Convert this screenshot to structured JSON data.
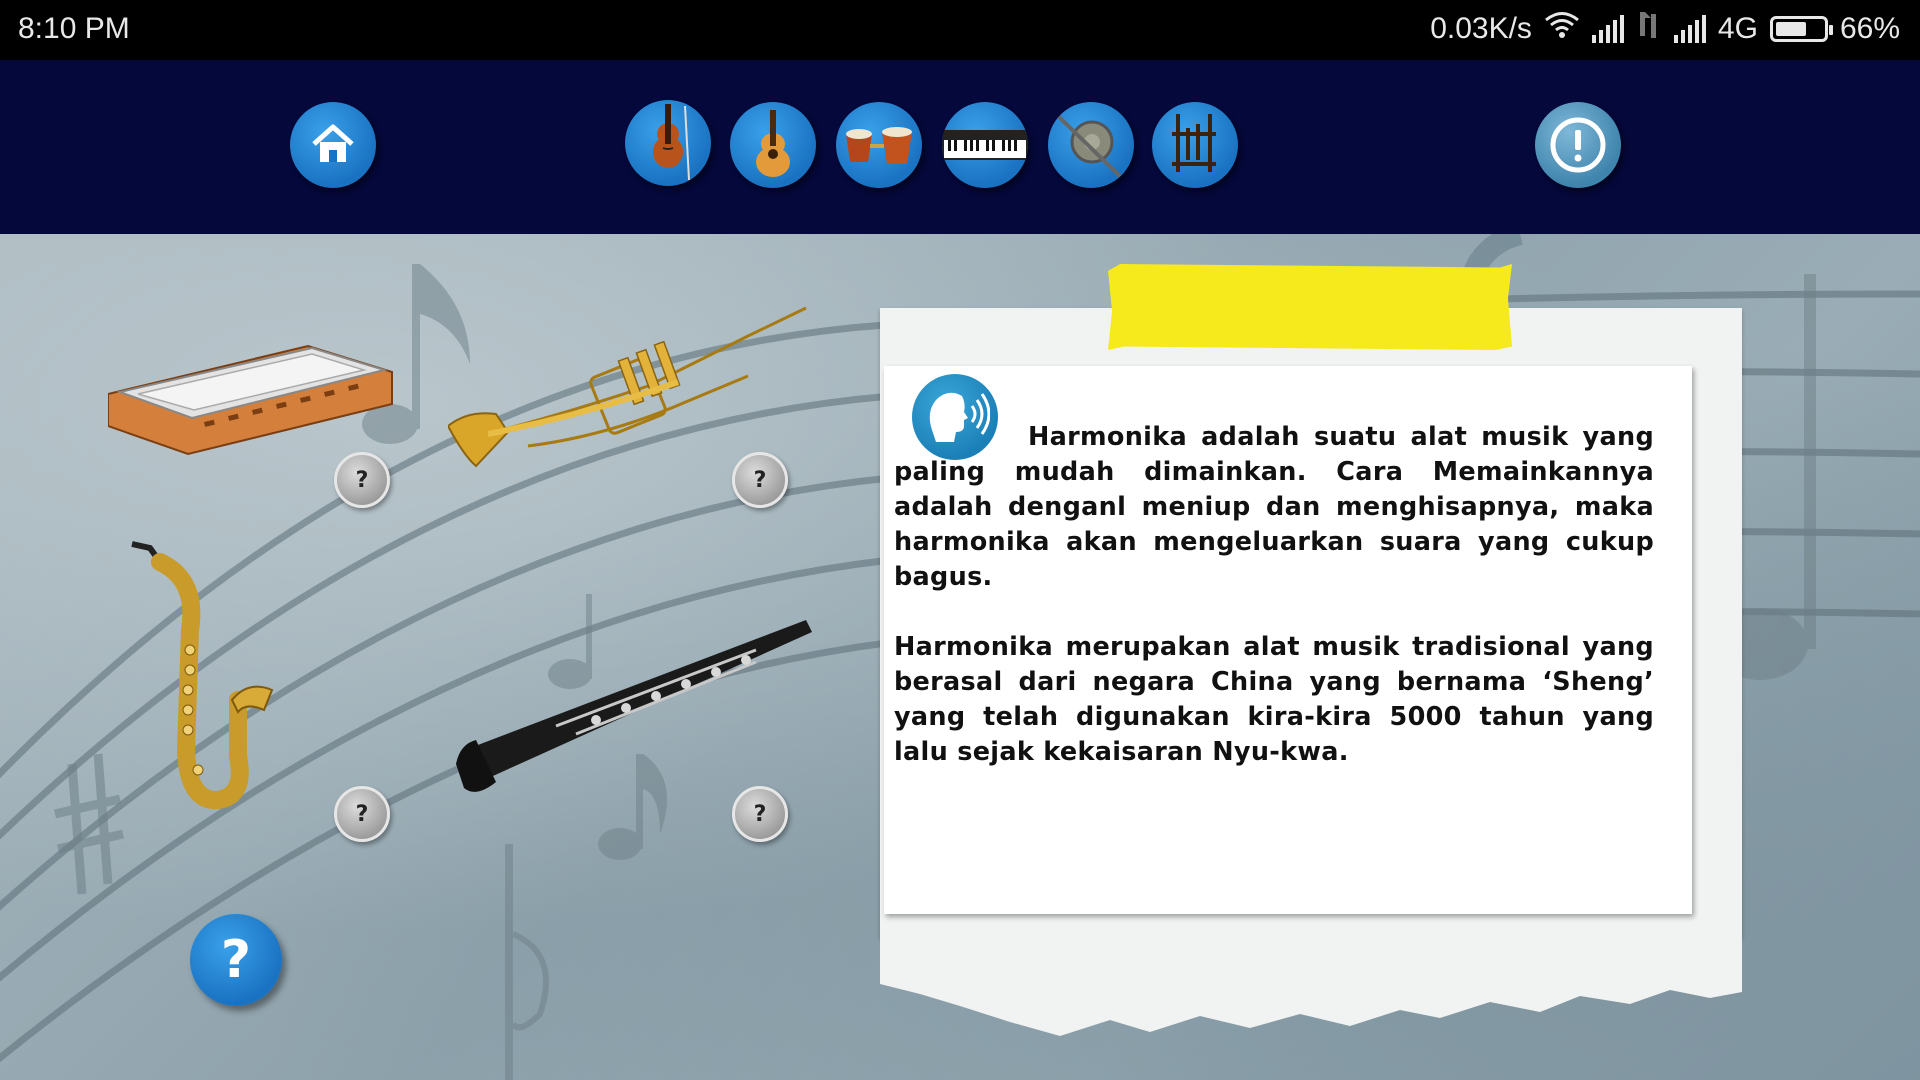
{
  "status_bar": {
    "time": "8:10 PM",
    "net_speed": "0.03K/s",
    "network_type": "4G",
    "battery_percent": "66%",
    "battery_level": 0.66
  },
  "nav": {
    "buttons": [
      {
        "name": "home-button",
        "icon": "home-icon"
      },
      {
        "name": "violin-category-button",
        "icon": "violin-icon"
      },
      {
        "name": "guitar-category-button",
        "icon": "guitar-icon"
      },
      {
        "name": "drums-category-button",
        "icon": "bongo-drums-icon"
      },
      {
        "name": "keyboard-category-button",
        "icon": "piano-keyboard-icon"
      },
      {
        "name": "gong-category-button",
        "icon": "gong-icon"
      },
      {
        "name": "angklung-category-button",
        "icon": "angklung-icon"
      },
      {
        "name": "info-button",
        "icon": "exclamation-icon"
      }
    ]
  },
  "instruments": [
    {
      "name": "harmonica",
      "icon": "harmonica-image"
    },
    {
      "name": "trumpet",
      "icon": "trumpet-image"
    },
    {
      "name": "saxophone",
      "icon": "saxophone-image"
    },
    {
      "name": "clarinet",
      "icon": "clarinet-image"
    }
  ],
  "question_button_label": "?",
  "help_button_label": "?",
  "note": {
    "paragraph1": "Harmonika adalah suatu alat musik yang paling mudah dimainkan. Cara Memainkannya adalah denganl meniup dan menghisapnya, maka harmonika akan mengeluarkan suara yang cukup bagus.",
    "paragraph2": "Harmonika merupakan alat musik tradisional yang berasal dari negara China yang bernama ‘Sheng’ yang telah digunakan kira-kira 5000 tahun yang lalu sejak kekaisaran Nyu-kwa.",
    "tape_color": "#f6ea1c"
  },
  "colors": {
    "nav_bg": "#05083a",
    "accent_blue": "#1a73c2"
  }
}
